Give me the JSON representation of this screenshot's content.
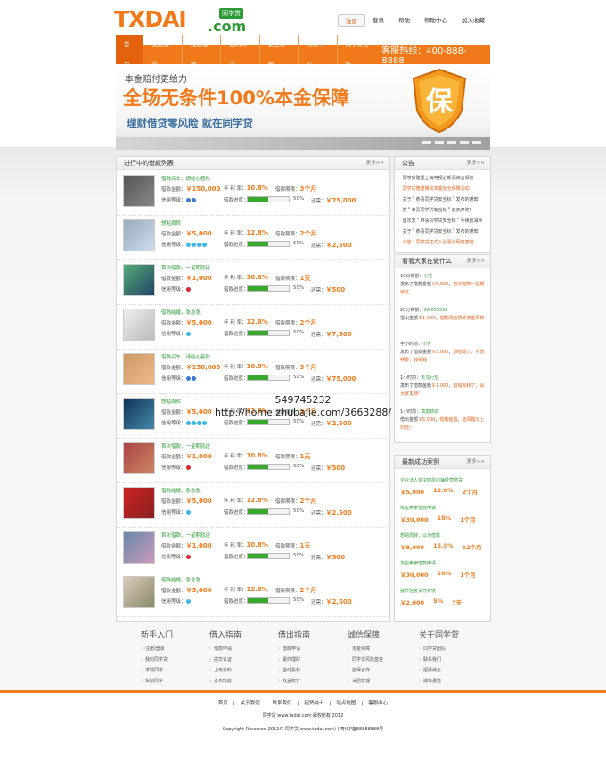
{
  "brand": {
    "logo_main": "TXDAI",
    "logo_sub": ".com",
    "logo_tag": "同学贷"
  },
  "toplinks": [
    "注册",
    "登录",
    "帮助",
    "帮助中心",
    "加入收藏"
  ],
  "nav": {
    "items": [
      "首页",
      "我要投资",
      "我要借款",
      "我的同学",
      "安全保障",
      "帮助中心",
      "同学贷论坛"
    ],
    "hotline": "客服热线：400-888-8888"
  },
  "banner": {
    "line1": "本金赔付更给力",
    "line2": "全场无条件100%本金保障",
    "line3": "理财借贷零风险 就在同学贷",
    "shield_char": "保"
  },
  "loans": {
    "title": "进行中的借款列表",
    "more": "更多>>",
    "rows": [
      {
        "title": "借钱买车，请给心若秋",
        "amount": "￥150,000",
        "rate": "10.8%",
        "term": "3个月",
        "progress": "50%",
        "total": "￥75,000",
        "icons": "credit"
      },
      {
        "title": "想贴周转",
        "amount": "￥5,000",
        "rate": "12.8%",
        "term": "2个月",
        "progress": "50%",
        "total": "￥2,500",
        "icons": "gem"
      },
      {
        "title": "首次借款，一星期就还",
        "amount": "￥1,000",
        "rate": "10.8%",
        "term": "1天",
        "progress": "50%",
        "total": "￥500",
        "icons": "heart"
      },
      {
        "title": "借钱结婚，急急急",
        "amount": "￥5,000",
        "rate": "12.8%",
        "term": "2个月",
        "progress": "50%",
        "total": "￥7,500",
        "icons": "gem1"
      },
      {
        "title": "借钱买车，请给心若秋",
        "amount": "￥150,000",
        "rate": "10.8%",
        "term": "3个月",
        "progress": "50%",
        "total": "￥75,000",
        "icons": "credit"
      },
      {
        "title": "想贴周转",
        "amount": "￥5,000",
        "rate": "12.8%",
        "term": "2个月",
        "progress": "50%",
        "total": "￥2,500",
        "icons": "gem"
      },
      {
        "title": "首次借款，一星期就还",
        "amount": "￥1,000",
        "rate": "10.8%",
        "term": "1天",
        "progress": "50%",
        "total": "￥500",
        "icons": "heart"
      },
      {
        "title": "借钱结婚，急急急",
        "amount": "￥5,000",
        "rate": "12.8%",
        "term": "2个月",
        "progress": "50%",
        "total": "￥2,500",
        "icons": "gem1"
      },
      {
        "title": "首次借款，一星期就还",
        "amount": "￥1,000",
        "rate": "10.8%",
        "term": "1天",
        "progress": "50%",
        "total": "￥500",
        "icons": "heart"
      },
      {
        "title": "借钱结婚，急急急",
        "amount": "￥5,000",
        "rate": "12.8%",
        "term": "2个月",
        "progress": "50%",
        "total": "￥2,500",
        "icons": "gem1"
      }
    ],
    "labels": {
      "amount": "借款金额：",
      "rate": "年 利 率：",
      "term": "借款期限：",
      "credit": "信用等级：",
      "progress": "借款进度：",
      "total": "还需："
    }
  },
  "notice": {
    "title": "公告",
    "more": "更多>>",
    "items": [
      {
        "t": "同学贷隆重上海电视台新闻综合频道",
        "hl": false
      },
      {
        "t": "同学贷隆重推出本金完全保障活动",
        "hl": true
      },
      {
        "t": "关于＂恭喜同学贷安全标＂发布的通知",
        "hl": false
      },
      {
        "t": "发＂恭喜同学贷安全标＂天天开奖!",
        "hl": false
      },
      {
        "t": "首次发＂恭喜同学贷安全标＂手续费减半",
        "hl": false
      },
      {
        "t": "关于＂恭喜同学贷安全标＂发布的通知",
        "hl": false
      },
      {
        "t": "公告：同学贷正式入驻嘉兴网商基地",
        "hl": true
      }
    ]
  },
  "watch": {
    "title": "看看大家在做什么",
    "more": "更多>>",
    "items": [
      {
        "time": "10分钟前：",
        "user": "小艾",
        "l2a": "发布了借款金额",
        "amt": "￥5,000",
        "l2b": "，",
        "link": "首次借款一星期就还"
      },
      {
        "time": "20分钟前：",
        "user": "SW055555",
        "l2a": "借出金额",
        "amt": "￥1,000",
        "l2b": "，",
        "link": "借款网店购货资金周转"
      },
      {
        "time": "半小时前：",
        "user": "小芳",
        "l2a": "发布了借款金额",
        "amt": "￥5,000",
        "l2b": "，",
        "link": "想结婚了，不想啊要，钱钱钱"
      },
      {
        "time": "1小时前：",
        "user": "天马行空",
        "l2a": "发布了借款金额",
        "amt": "￥1,000",
        "l2b": "，",
        "link": "借钱周转了，请大家支持!"
      },
      {
        "time": "1小时前：",
        "user": "章韵劲动",
        "l2a": "借出金额",
        "amt": "￥5,000",
        "l2b": "，",
        "link": "借钱结婚，结冈婚马上归还!"
      }
    ]
  },
  "success": {
    "title": "最新成功案例",
    "more": "更多>>",
    "items": [
      {
        "t": "企业法人淘宝四星店铺经营借贷",
        "a": "￥5,000",
        "r": "12.8%",
        "m": "2个月"
      },
      {
        "t": "淘宝卖家借款申请",
        "a": "￥30,000",
        "r": "10%",
        "m": "1个月"
      },
      {
        "t": "想贴周转，以为借款",
        "a": "￥8,000",
        "r": "15.5%",
        "m": "12个月"
      },
      {
        "t": "淘宝卖家借款申请",
        "a": "￥30,000",
        "r": "10%",
        "m": "1个月"
      },
      {
        "t": "提升信誉贷分析低",
        "a": "￥2,000",
        "r": "5%",
        "m": "7天"
      }
    ]
  },
  "footer_cols": [
    {
      "h": "新手入门",
      "items": [
        "注册/登录",
        "我的同学贷",
        "求助同学",
        "资助同学"
      ]
    },
    {
      "h": "借入指南",
      "items": [
        "借款申请",
        "提交认证",
        "上传资料",
        "发布借款"
      ]
    },
    {
      "h": "借出指南",
      "items": [
        "借款申请",
        "委托理财",
        "自动投标",
        "收益统计"
      ]
    },
    {
      "h": "诚信保障",
      "items": [
        "本金保障",
        "同学贷风险基金",
        "担保合作",
        "贷后管理"
      ]
    },
    {
      "h": "关于同学贷",
      "items": [
        "同学贷团队",
        "联系我们",
        "招贤纳士",
        "媒体报道"
      ]
    }
  ],
  "footer_links": [
    "首页",
    "关于我们",
    "联系我们",
    "招贤纳士",
    "站点地图",
    "客服中心"
  ],
  "footer_line2": "同学贷 www.txdai.com 版权所有 2012",
  "footer_line3": "Copyright Reserved 2012© 同学贷(www.txdai.com) | 粤ICP备88888888号",
  "watermark": {
    "line1": "549745232",
    "line2": "http://home.zhubajie.com/3663288/"
  },
  "colors": {
    "accent": "#f07a1a",
    "green": "#2e9a34"
  }
}
